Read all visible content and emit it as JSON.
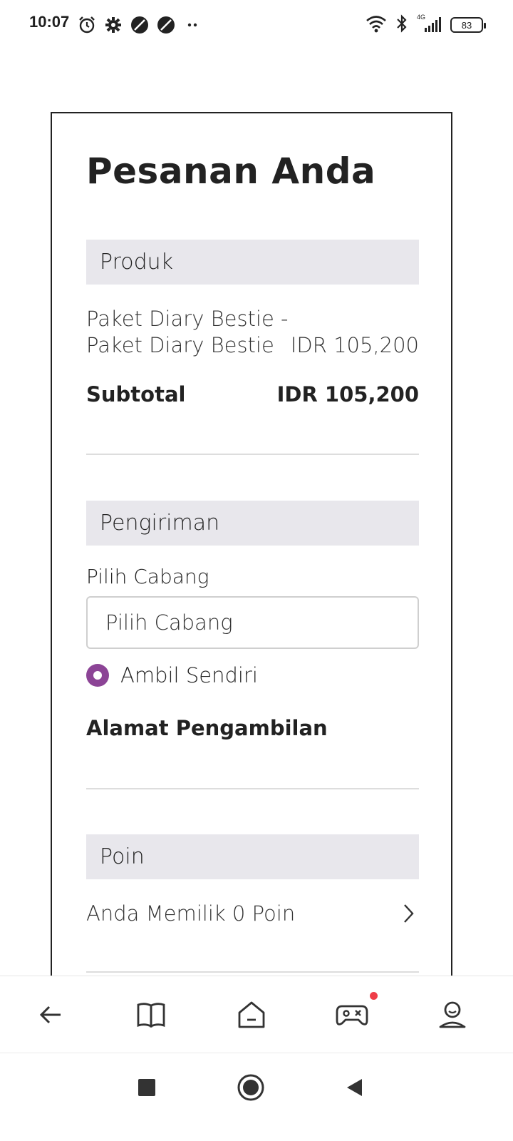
{
  "status_bar": {
    "time": "10:07",
    "battery": "83",
    "network": "4G",
    "icons": [
      "alarm-icon",
      "gear-icon",
      "app-icon",
      "app-icon",
      "more-dots-icon",
      "wifi-icon",
      "bluetooth-icon",
      "signal-icon",
      "battery-icon"
    ]
  },
  "page": {
    "title": "Pesanan Anda"
  },
  "product_section": {
    "header": "Produk",
    "item_line1": "Paket Diary Bestie -",
    "item_line2": "Paket Diary Bestie",
    "item_price": "IDR 105,200",
    "subtotal_label": "Subtotal",
    "subtotal_value": "IDR 105,200"
  },
  "shipping_section": {
    "header": "Pengiriman",
    "branch_label": "Pilih Cabang",
    "branch_select_value": "Pilih Cabang",
    "pickup_option": "Ambil Sendiri",
    "pickup_address_heading": "Alamat Pengambilan"
  },
  "points_section": {
    "header": "Poin",
    "points_text": "Anda Memilik 0 Poin"
  },
  "app_nav": {
    "items": [
      "back-arrow-icon",
      "book-icon",
      "home-icon",
      "gamepad-icon",
      "profile-icon"
    ],
    "accent_color": "#8c4496",
    "notification_color": "#ef3d48"
  },
  "system_nav": {
    "items": [
      "recents-icon",
      "home-circle-icon",
      "back-triangle-icon"
    ]
  }
}
